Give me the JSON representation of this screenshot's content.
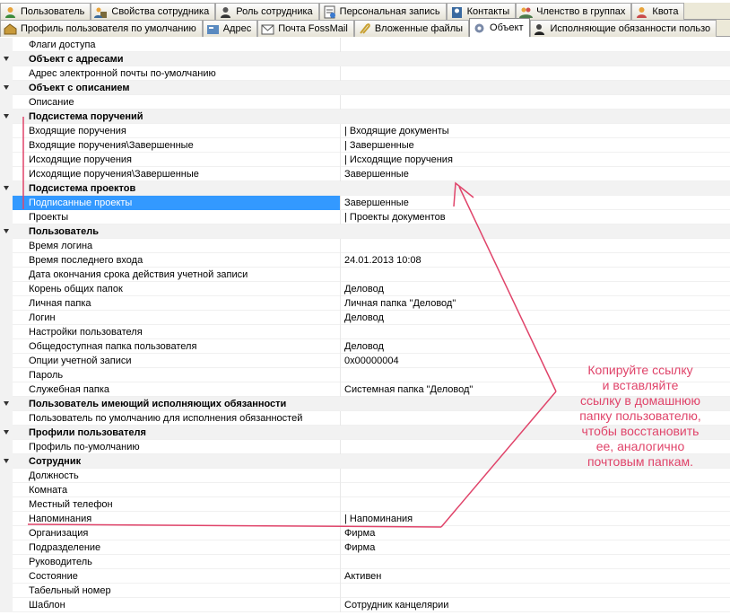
{
  "tabs_row1": [
    {
      "label": "Пользователь",
      "icon": "user-icon"
    },
    {
      "label": "Свойства сотрудника",
      "icon": "employee-properties-icon"
    },
    {
      "label": "Роль сотрудника",
      "icon": "employee-role-icon"
    },
    {
      "label": "Персональная запись",
      "icon": "personal-record-icon"
    },
    {
      "label": "Контакты",
      "icon": "contacts-icon"
    },
    {
      "label": "Членство в группах",
      "icon": "group-membership-icon"
    },
    {
      "label": "Квота",
      "icon": "quota-icon"
    }
  ],
  "tabs_row2": [
    {
      "label": "Профиль пользователя по умолчанию",
      "icon": "profile-icon",
      "active": false
    },
    {
      "label": "Адрес",
      "icon": "address-icon",
      "active": false
    },
    {
      "label": "Почта FossMail",
      "icon": "mail-icon",
      "active": false
    },
    {
      "label": "Вложенные файлы",
      "icon": "attachment-icon",
      "active": false
    },
    {
      "label": "Объект",
      "icon": "gear-icon",
      "active": true
    },
    {
      "label": "Исполняющие обязанности пользо",
      "icon": "deputies-icon",
      "active": false
    }
  ],
  "rows": [
    {
      "type": "prop",
      "name": "Флаги доступа",
      "value": ""
    },
    {
      "type": "cat",
      "name": "Объект с адресами"
    },
    {
      "type": "prop",
      "name": "Адрес электронной почты по-умолчанию",
      "value": ""
    },
    {
      "type": "cat",
      "name": "Объект с описанием"
    },
    {
      "type": "prop",
      "name": "Описание",
      "value": ""
    },
    {
      "type": "cat",
      "name": "Подсистема поручений"
    },
    {
      "type": "prop",
      "name": "Входящие поручения",
      "value": "| Входящие документы"
    },
    {
      "type": "prop",
      "name": "Входящие поручения\\Завершенные",
      "value": "| Завершенные"
    },
    {
      "type": "prop",
      "name": "Исходящие поручения",
      "value": "| Исходящие поручения"
    },
    {
      "type": "prop",
      "name": "Исходящие поручения\\Завершенные",
      "value": "Завершенные"
    },
    {
      "type": "cat",
      "name": "Подсистема проектов"
    },
    {
      "type": "prop",
      "name": "Подписанные проекты",
      "value": "Завершенные",
      "selected": true
    },
    {
      "type": "prop",
      "name": "Проекты",
      "value": "| Проекты документов"
    },
    {
      "type": "cat",
      "name": "Пользователь"
    },
    {
      "type": "prop",
      "name": "Время логина",
      "value": ""
    },
    {
      "type": "prop",
      "name": "Время последнего входа",
      "value": "24.01.2013 10:08"
    },
    {
      "type": "prop",
      "name": "Дата окончания срока действия учетной записи",
      "value": ""
    },
    {
      "type": "prop",
      "name": "Корень общих папок",
      "value": "Деловод"
    },
    {
      "type": "prop",
      "name": "Личная папка",
      "value": "Личная папка \"Деловод\""
    },
    {
      "type": "prop",
      "name": "Логин",
      "value": "Деловод"
    },
    {
      "type": "prop",
      "name": "Настройки пользователя",
      "value": ""
    },
    {
      "type": "prop",
      "name": "Общедоступная папка пользователя",
      "value": "Деловод"
    },
    {
      "type": "prop",
      "name": "Опции учетной записи",
      "value": "0x00000004"
    },
    {
      "type": "prop",
      "name": "Пароль",
      "value": ""
    },
    {
      "type": "prop",
      "name": "Служебная папка",
      "value": "Системная папка \"Деловод\""
    },
    {
      "type": "cat",
      "name": "Пользователь имеющий исполняющих обязанности"
    },
    {
      "type": "prop",
      "name": "Пользователь по умолчанию для исполнения обязанностей",
      "value": ""
    },
    {
      "type": "cat",
      "name": "Профили пользователя"
    },
    {
      "type": "prop",
      "name": "Профиль по-умолчанию",
      "value": ""
    },
    {
      "type": "cat",
      "name": "Сотрудник"
    },
    {
      "type": "prop",
      "name": "Должность",
      "value": ""
    },
    {
      "type": "prop",
      "name": "Комната",
      "value": ""
    },
    {
      "type": "prop",
      "name": "Местный телефон",
      "value": ""
    },
    {
      "type": "prop",
      "name": "Напоминания",
      "value": "| Напоминания"
    },
    {
      "type": "prop",
      "name": "Организация",
      "value": "Фирма"
    },
    {
      "type": "prop",
      "name": "Подразделение",
      "value": "Фирма"
    },
    {
      "type": "prop",
      "name": "Руководитель",
      "value": ""
    },
    {
      "type": "prop",
      "name": "Состояние",
      "value": "Активен"
    },
    {
      "type": "prop",
      "name": "Табельный номер",
      "value": ""
    },
    {
      "type": "prop",
      "name": "Шаблон",
      "value": "Сотрудник канцелярии"
    }
  ],
  "annotation": {
    "lines": [
      "Копируйте ссылку",
      "и вставляйте",
      "ссылку в домашнюю",
      "папку пользователю,",
      "чтобы восстановить",
      "ее, аналогично",
      "почтовым папкам."
    ],
    "color": "#e0446a"
  },
  "colors": {
    "selection": "#3399ff",
    "category_bg": "#f2f2f2"
  }
}
